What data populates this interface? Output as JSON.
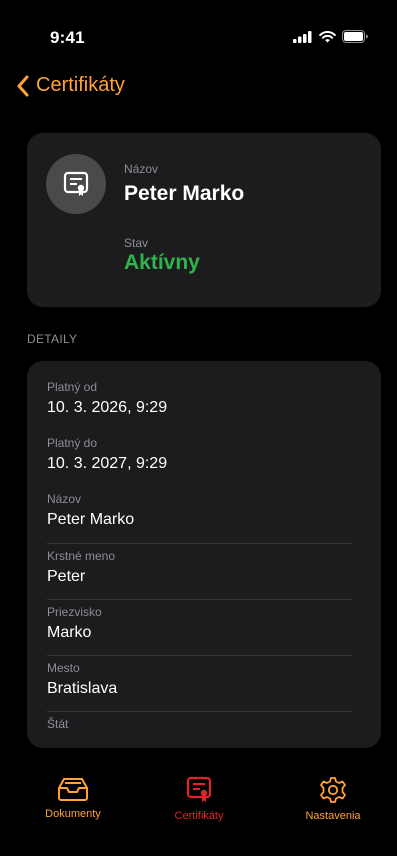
{
  "status": {
    "time": "9:41"
  },
  "nav": {
    "back_label": "Certifikáty"
  },
  "header_card": {
    "name_label": "Názov",
    "name_value": "Peter Marko",
    "state_label": "Stav",
    "state_value": "Aktívny",
    "state_color": "#30b34a"
  },
  "details": {
    "section_title": "DETAILY",
    "rows": [
      {
        "label": "Platný od",
        "value": "10. 3. 2026, 9:29"
      },
      {
        "label": "Platný do",
        "value": "10. 3. 2027, 9:29"
      },
      {
        "label": "Názov",
        "value": "Peter Marko"
      },
      {
        "label": "Krstné meno",
        "value": "Peter"
      },
      {
        "label": "Priezvisko",
        "value": "Marko"
      },
      {
        "label": "Mesto",
        "value": "Bratislava"
      },
      {
        "label": "Štát",
        "value": ""
      }
    ]
  },
  "tabs": [
    {
      "label": "Dokumenty",
      "icon": "tray-icon",
      "active": false
    },
    {
      "label": "Certifikáty",
      "icon": "certificate-icon",
      "active": true
    },
    {
      "label": "Nastavenia",
      "icon": "gear-icon",
      "active": false
    }
  ],
  "colors": {
    "accent": "#ff9f0a",
    "active_tab": "#e5202b",
    "inactive_tab": "#ffa23a"
  }
}
